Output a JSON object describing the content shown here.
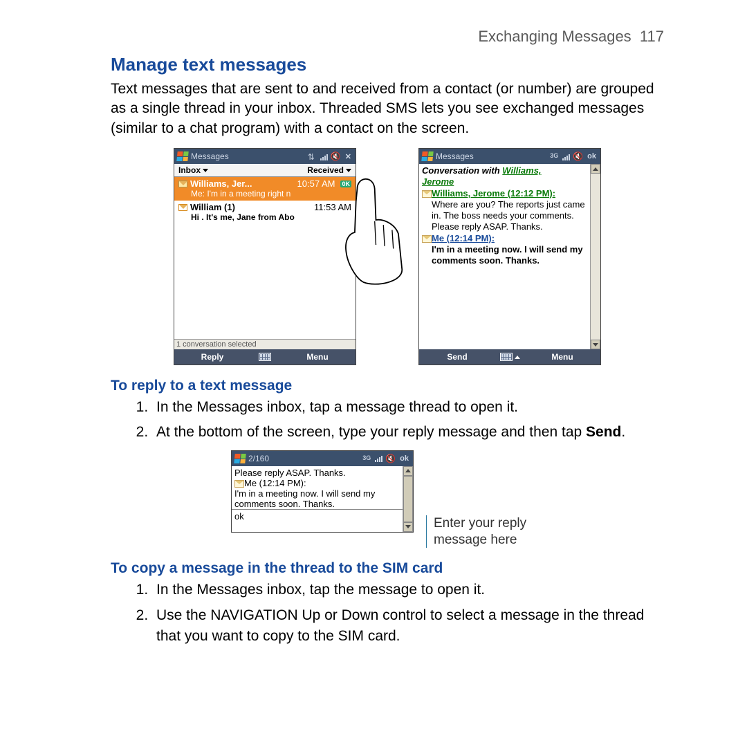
{
  "header": {
    "chapter": "Exchanging Messages",
    "page": "117"
  },
  "h2": "Manage text messages",
  "intro": "Text messages that are sent to and received from a contact (or number) are grouped as a single thread in your inbox. Threaded SMS lets you see exchanged messages (similar to a chat program) with a contact on the screen.",
  "screenshot_a": {
    "title": "Messages",
    "filter_left": "Inbox",
    "filter_right": "Received",
    "row1_name": "Williams, Jer...",
    "row1_time": "10:57 AM",
    "row1_badge": "0K",
    "row1_preview": "Me: I'm in a meeting right n",
    "row2_name": "William (1)",
    "row2_time": "11:53 AM",
    "row2_preview": "Hi . It's me, Jane from Abo",
    "status": "1 conversation selected",
    "sk_left": "Reply",
    "sk_right": "Menu"
  },
  "screenshot_b": {
    "title": "Messages",
    "ok": "ok",
    "convo_with": "Conversation with ",
    "convo_name_a": "Williams,",
    "convo_name_b": "Jerome",
    "sender1": "Williams, Jerome (12:12 PM):",
    "msg1": "Where are you? The reports just came in. The boss needs your comments. Please reply ASAP. Thanks.",
    "sender2": "Me (12:14 PM):",
    "msg2": "I'm in a meeting now. I will send my comments soon. Thanks.",
    "sk_left": "Send",
    "sk_right": "Menu"
  },
  "h3a": "To reply to a text message",
  "reply_steps": {
    "s1": "In the Messages inbox, tap a message thread to open it.",
    "s2_a": "At the bottom of the screen, type your reply message and then tap ",
    "s2_b": "Send",
    "s2_c": "."
  },
  "screenshot_c": {
    "title": "2/160",
    "ok": "ok",
    "prev": "Please reply ASAP. Thanks.",
    "sender": "Me (12:14 PM):",
    "msg": "I'm in a meeting now. I will send my comments soon. Thanks.",
    "input": "ok"
  },
  "callout": "Enter your reply message here",
  "h3b": "To copy a message in the thread to the SIM card",
  "sim_steps": {
    "s1": "In the Messages inbox, tap the message to open it.",
    "s2": "Use the NAVIGATION Up or Down control to select a message in the thread that you want to copy to the SIM card."
  }
}
